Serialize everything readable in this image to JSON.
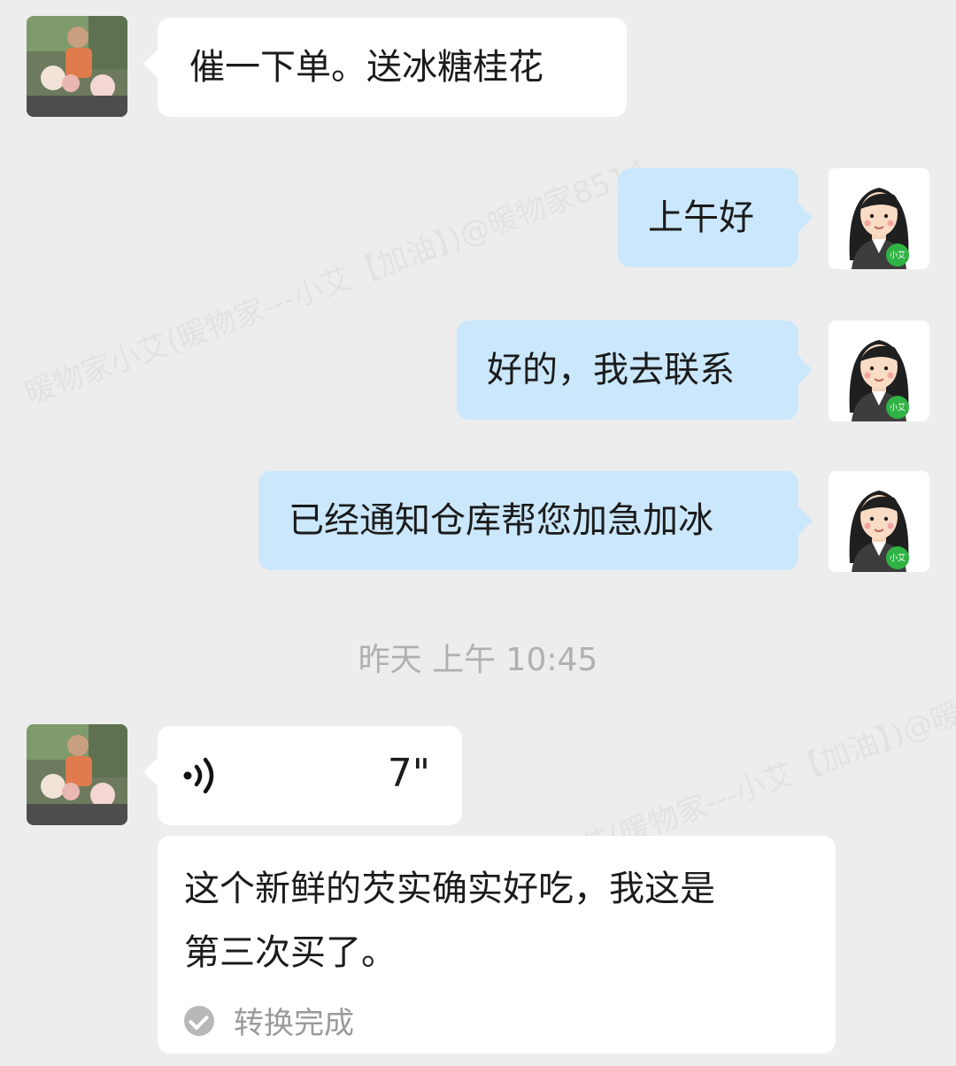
{
  "watermark": {
    "text": "暖物家小艾(暖物家---小艾【加油】)@暖物家8514"
  },
  "agent": {
    "badge": "小艾"
  },
  "messages": {
    "m1": "催一下单。送冰糖桂花",
    "m2": "上午好",
    "m3": "好的，我去联系",
    "m4": "已经通知仓库帮您加急加冰"
  },
  "timestamp": "昨天  上午 10:45",
  "voice": {
    "duration": "7\"",
    "transcript": [
      "这个新鲜的芡实确实好吃，我这是",
      "第三次买了。"
    ],
    "status": "转换完成"
  },
  "colors": {
    "background": "#ededed",
    "left_bubble": "#ffffff",
    "right_bubble": "#cbe7fb",
    "badge": "#2fb344"
  }
}
